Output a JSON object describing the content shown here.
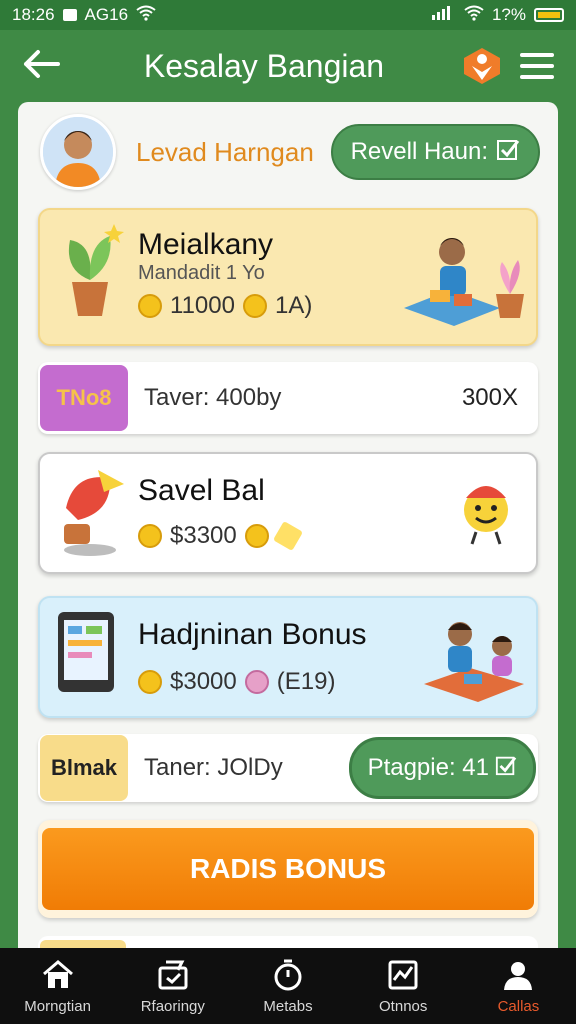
{
  "status_bar": {
    "time": "18:26",
    "carrier": "AG16",
    "battery": "1?%"
  },
  "header": {
    "title": "Kesalay Bangian"
  },
  "profile": {
    "name": "Levad Harngan",
    "reveal_button": "Revell Haun:"
  },
  "cards": [
    {
      "title": "Meialkany",
      "subtitle": "Mandadit 1 Yo",
      "amount": "11000",
      "extra": "1A)"
    },
    {
      "title": "Savel Bal",
      "amount": "$3300"
    },
    {
      "title": "Hadjninan Bonus",
      "amount": "$3000",
      "extra": "(E19)"
    }
  ],
  "row_taver": {
    "tag": "TNo8",
    "text": "Taver: 400by",
    "value": "300Χ"
  },
  "row_taner": {
    "tag": "Blmak",
    "text": "Taner: JOlDy",
    "button": "Ptagpie: 41"
  },
  "bonus_button": {
    "label": "RADIS BONUS"
  },
  "bottom_nav": [
    {
      "label": "Morngtian",
      "icon": "home-icon"
    },
    {
      "label": "Rfaoringy",
      "icon": "ticket-icon"
    },
    {
      "label": "Metabs",
      "icon": "timer-icon"
    },
    {
      "label": "Otnnos",
      "icon": "chart-icon"
    },
    {
      "label": "Callas",
      "icon": "profile-icon",
      "active": true
    }
  ],
  "colors": {
    "primary_green": "#3f8a45",
    "accent_orange": "#f07c05",
    "active_nav": "#e85a2c"
  }
}
